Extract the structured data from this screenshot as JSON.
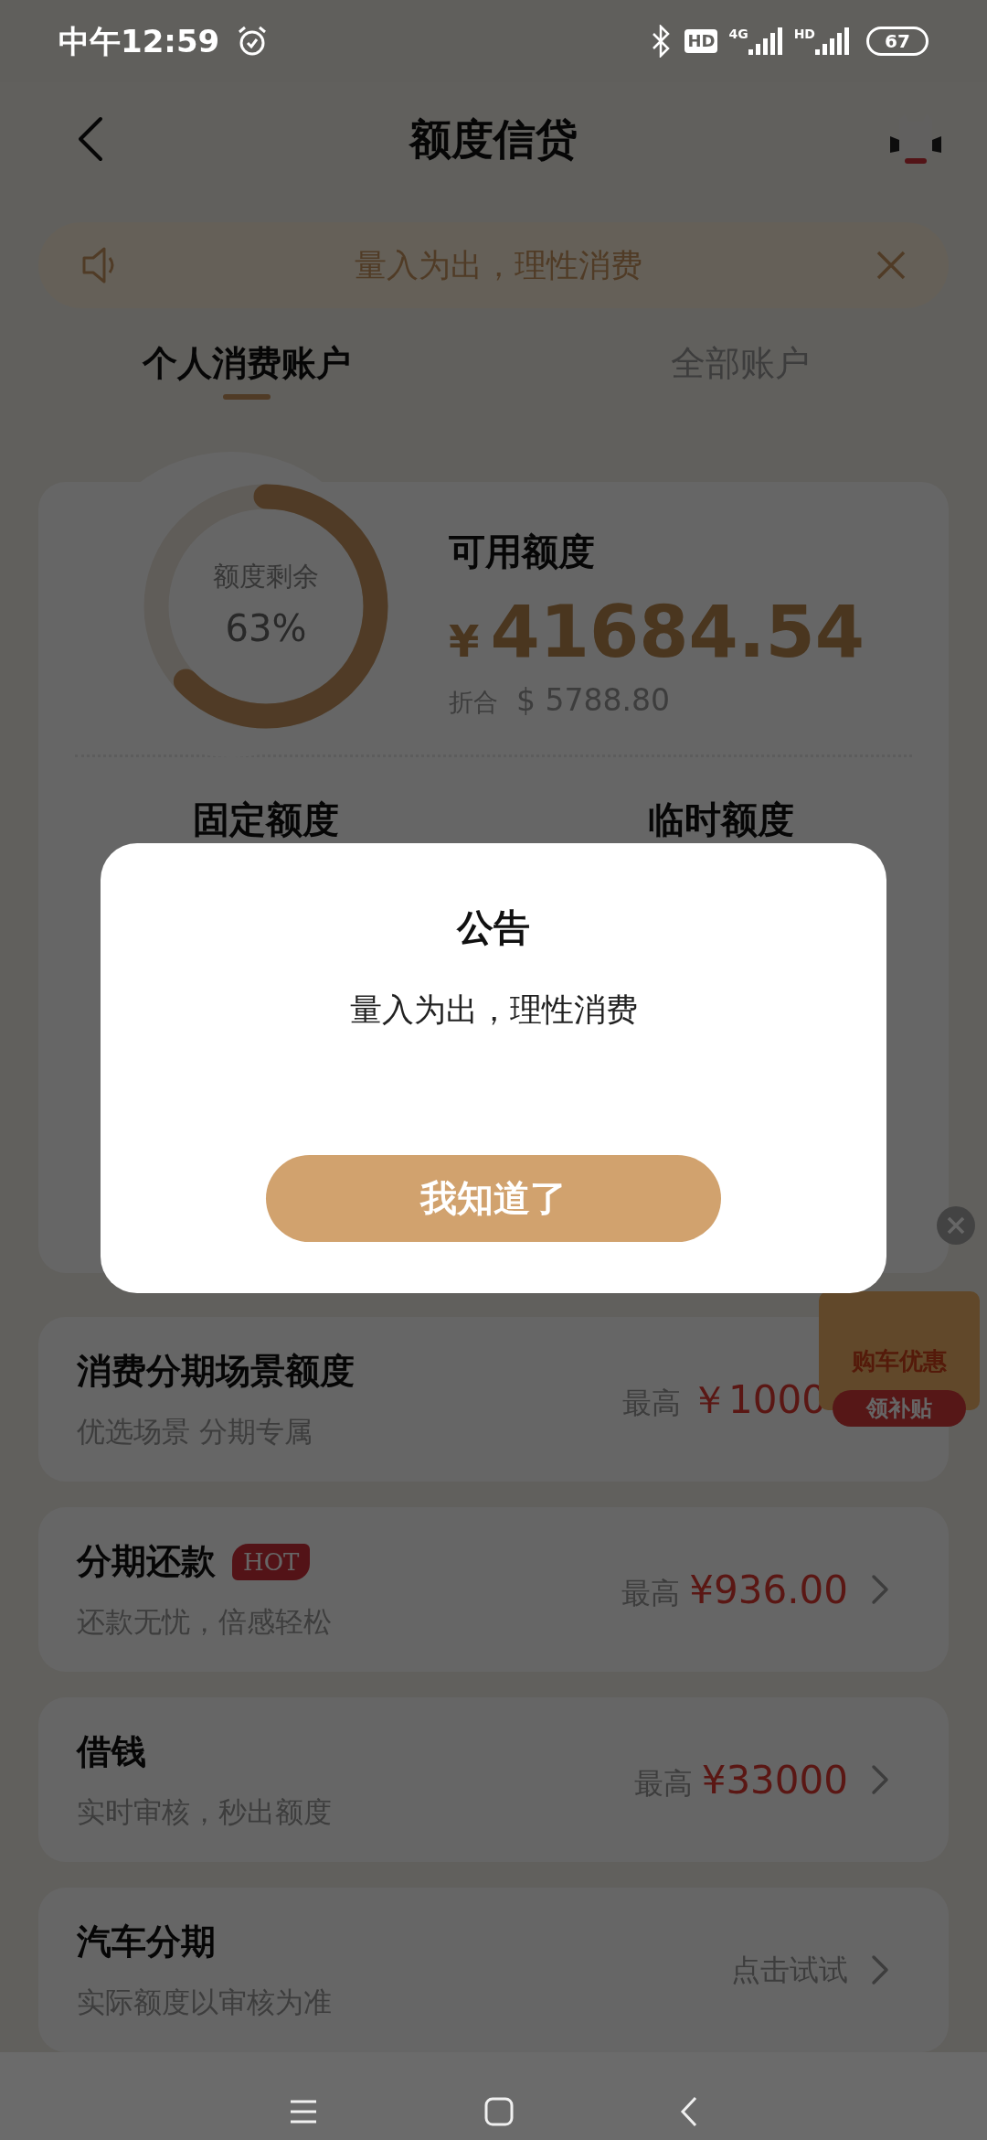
{
  "status_bar": {
    "time": "中午12:59",
    "hd_badge": "HD",
    "sim1_label": "4G",
    "sim2_label": "HD",
    "battery": "67"
  },
  "header": {
    "title": "额度信贷"
  },
  "notice_bar": {
    "text": "量入为出，理性消费"
  },
  "tabs": [
    {
      "label": "个人消费账户",
      "selected": true
    },
    {
      "label": "全部账户",
      "selected": false
    }
  ],
  "credit_card": {
    "donut_label": "额度剩余",
    "donut_value": "63%",
    "title": "可用额度",
    "currency": "¥",
    "amount": "41684.54",
    "converted_label": "折合",
    "converted_amount": "$ 5788.80",
    "quotas": [
      "固定额度",
      "临时额度"
    ]
  },
  "products": [
    {
      "kind": "amount",
      "title": "消费分期场景额度",
      "subtitle": "优选场景 分期专属",
      "prefix": "最高",
      "value": "￥1000",
      "chevron": false
    },
    {
      "kind": "amount",
      "title": "分期还款",
      "badge": "HOT",
      "subtitle": "还款无忧，倍感轻松",
      "prefix": "最高",
      "value": "¥936.00",
      "chevron": true
    },
    {
      "kind": "amount",
      "title": "借钱",
      "subtitle": "实时审核，秒出额度",
      "prefix": "最高",
      "value": "¥33000",
      "chevron": true
    },
    {
      "kind": "hint",
      "title": "汽车分期",
      "subtitle": "实际额度以审核为准",
      "value": "点击试试",
      "chevron": true
    }
  ],
  "floating_ad": {
    "title": "购车优惠",
    "button": "领补贴"
  },
  "dialog": {
    "title": "公告",
    "message": "量入为出，理性消费",
    "button": "我知道了"
  }
}
